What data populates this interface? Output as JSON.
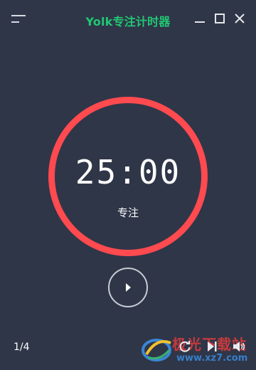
{
  "app": {
    "title": "Yolk专注计时器"
  },
  "timer": {
    "time": "25:00",
    "mode": "专注",
    "ring_color": "#ff4a4f"
  },
  "session": {
    "counter": "1/4"
  },
  "icons": {
    "menu": "menu-icon",
    "minimize": "minimize-icon",
    "maximize": "maximize-icon",
    "close": "close-icon",
    "play": "play-icon",
    "reset": "reset-icon",
    "skip": "skip-icon",
    "volume": "volume-icon"
  },
  "colors": {
    "background": "#2f3648",
    "accent_title": "#21c773",
    "ring": "#ff4a4f"
  },
  "watermark": {
    "line1": "极光下载站",
    "line2": "www.xz7.com"
  }
}
